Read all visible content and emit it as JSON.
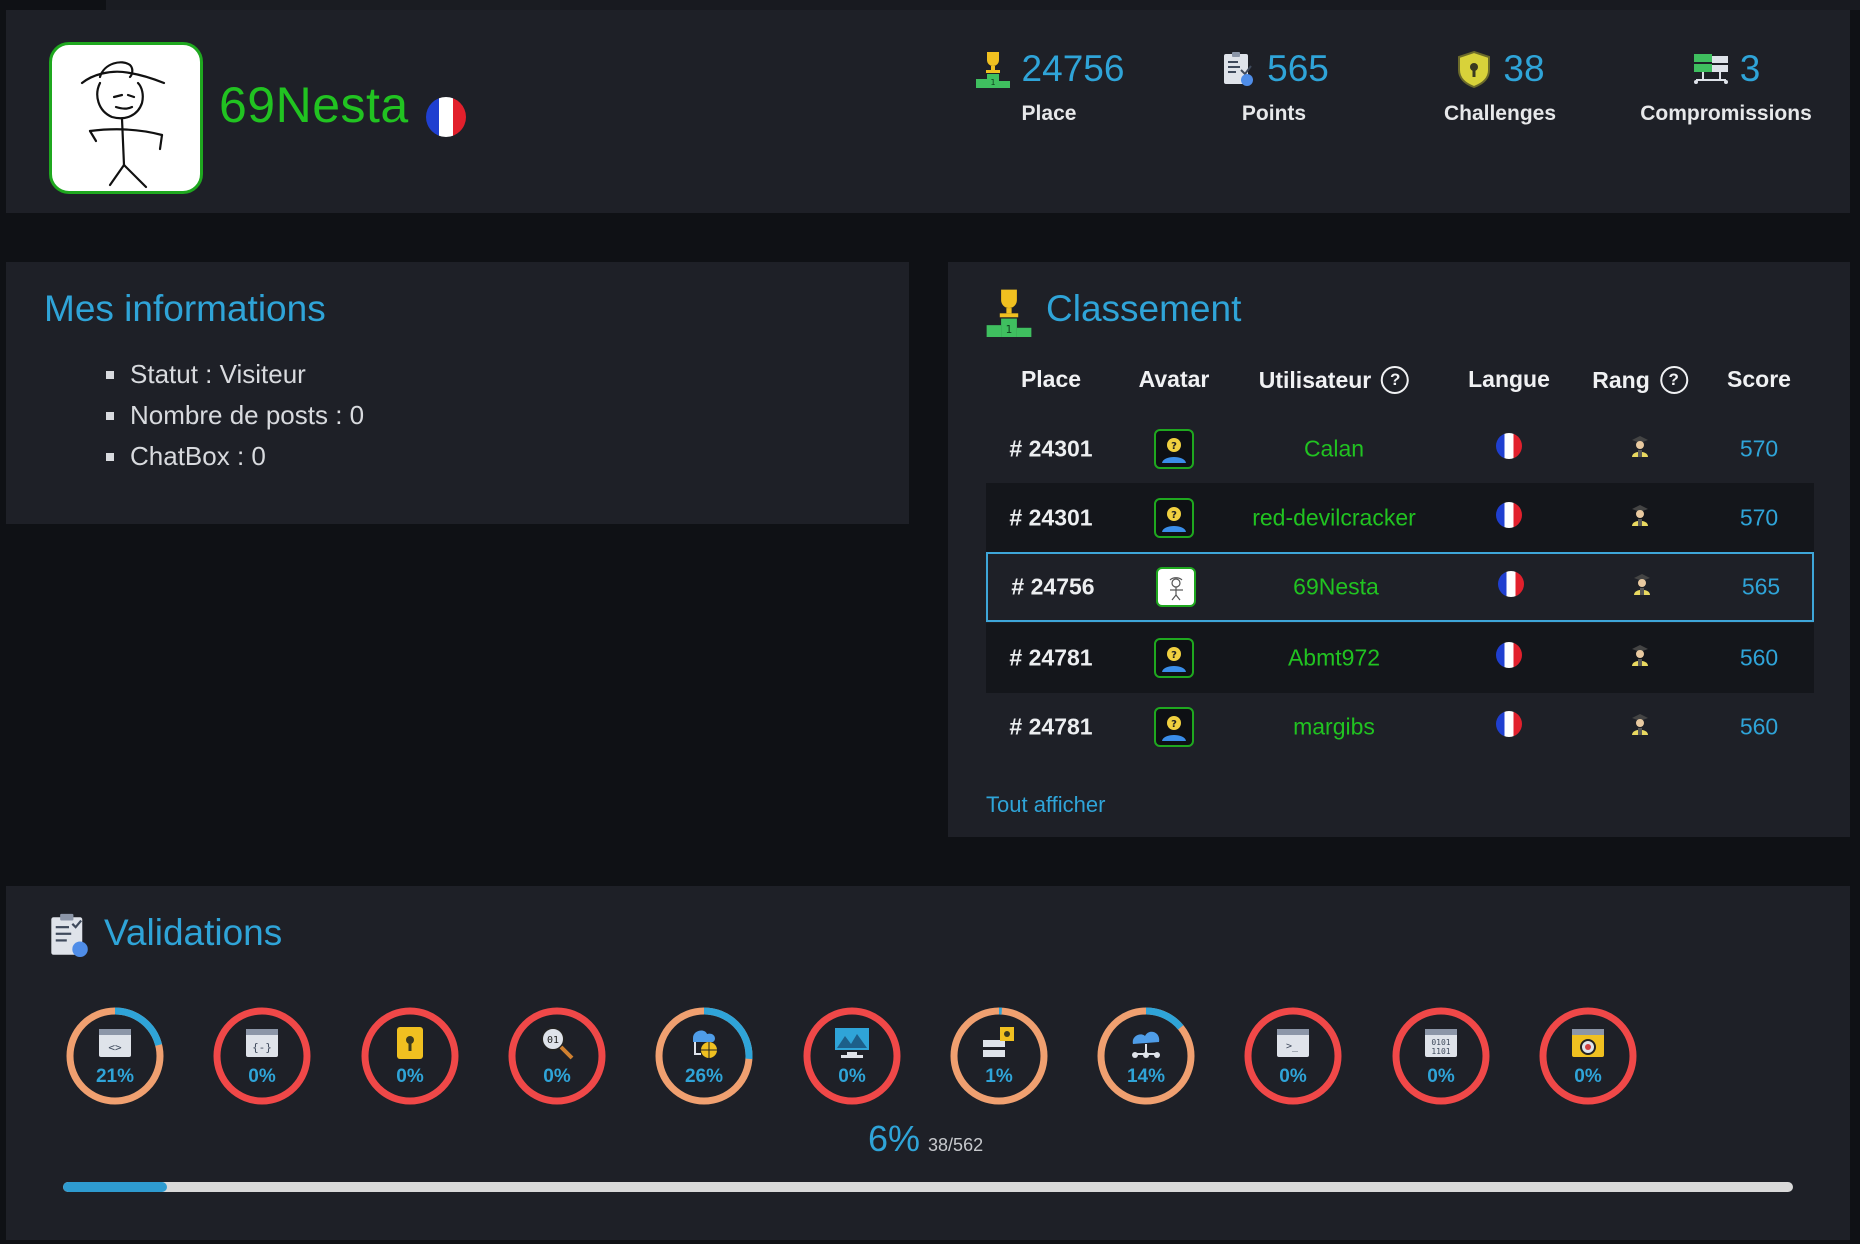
{
  "profile": {
    "username": "69Nesta",
    "country": "France"
  },
  "stats": [
    {
      "value": "24756",
      "label": "Place",
      "icon": "podium-trophy-icon"
    },
    {
      "value": "565",
      "label": "Points",
      "icon": "score-sheet-icon"
    },
    {
      "value": "38",
      "label": "Challenges",
      "icon": "shield-lock-icon"
    },
    {
      "value": "3",
      "label": "Compromissions",
      "icon": "servers-network-icon"
    }
  ],
  "info": {
    "title": "Mes informations",
    "items": [
      "Statut : Visiteur",
      "Nombre de posts : 0",
      "ChatBox : 0"
    ]
  },
  "ranking": {
    "title": "Classement",
    "headers": {
      "place": "Place",
      "avatar": "Avatar",
      "user": "Utilisateur",
      "lang": "Langue",
      "rank": "Rang",
      "score": "Score"
    },
    "help_glyph": "?",
    "rows": [
      {
        "place": "# 24301",
        "user": "Calan",
        "score": "570"
      },
      {
        "place": "# 24301",
        "user": "red-devilcracker",
        "score": "570"
      },
      {
        "place": "# 24756",
        "user": "69Nesta",
        "score": "565",
        "current": true
      },
      {
        "place": "# 24781",
        "user": "Abmt972",
        "score": "560"
      },
      {
        "place": "# 24781",
        "user": "margibs",
        "score": "560"
      }
    ],
    "show_all": "Tout afficher"
  },
  "validations": {
    "title": "Validations",
    "categories": [
      {
        "pct": 21,
        "label": "21%",
        "icon": "web-client-icon"
      },
      {
        "pct": 0,
        "label": "0%",
        "icon": "programming-icon"
      },
      {
        "pct": 0,
        "label": "0%",
        "icon": "cryptanalysis-lock-icon"
      },
      {
        "pct": 0,
        "label": "0%",
        "icon": "steganography-search-icon"
      },
      {
        "pct": 26,
        "label": "26%",
        "icon": "web-server-icon"
      },
      {
        "pct": 0,
        "label": "0%",
        "icon": "realist-icon"
      },
      {
        "pct": 1,
        "label": "1%",
        "icon": "network-icon"
      },
      {
        "pct": 14,
        "label": "14%",
        "icon": "cloud-network-icon"
      },
      {
        "pct": 0,
        "label": "0%",
        "icon": "app-script-terminal-icon"
      },
      {
        "pct": 0,
        "label": "0%",
        "icon": "app-system-binary-icon"
      },
      {
        "pct": 0,
        "label": "0%",
        "icon": "forensic-bug-icon"
      }
    ],
    "total_pct": "6%",
    "total_count": "38/562",
    "progress": 0.06
  },
  "colors": {
    "accent": "#2fa4d8",
    "user_green": "#21c321",
    "ring_empty": "#f04848",
    "ring_track_partial": "#f0a070",
    "ring_fill": "#2fa4d8"
  }
}
